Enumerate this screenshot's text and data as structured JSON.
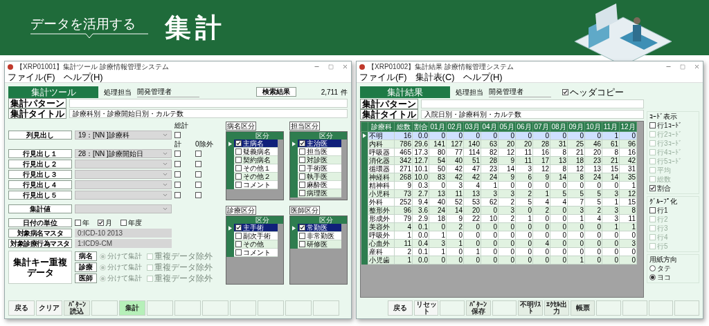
{
  "header": {
    "subtitle": "データを活用する",
    "title": "集計"
  },
  "tool_window": {
    "title": "【XRP01001】集計ツール 診療情報管理システム",
    "menu": [
      "ファイル(F)",
      "ヘルプ(H)"
    ],
    "heading": "集計ツール",
    "operator_label": "処理担当",
    "operator": "開発管理者",
    "search_button": "検索結果",
    "count": "2,711",
    "count_unit": "件",
    "pattern": {
      "label": "集計パターン"
    },
    "title_field": {
      "label": "集計タイトル",
      "value": "診療科別・診療開始日別・カルテ数"
    },
    "total_label": "総計",
    "sum_label": "計",
    "exclude_label": "0除外",
    "column_heading": {
      "label": "列見出し",
      "value": "19：[NN ]診療科",
      "total_checked": false
    },
    "row_headings": [
      {
        "label": "行見出し１",
        "value": "28：[NN ]診療開始日",
        "sum_checked": false,
        "exclude_checked": false
      },
      {
        "label": "行見出し２",
        "sum_checked": false,
        "exclude_checked": false
      },
      {
        "label": "行見出し３",
        "sum_checked": false,
        "exclude_checked": false
      },
      {
        "label": "行見出し４",
        "sum_checked": false,
        "exclude_checked": false
      },
      {
        "label": "行見出し５",
        "sum_checked": false,
        "exclude_checked": false
      }
    ],
    "value_field": {
      "label": "集計値"
    },
    "date_unit": {
      "label": "日付の単位",
      "options": [
        {
          "label": "年",
          "checked": false
        },
        {
          "label": "月",
          "checked": true
        },
        {
          "label": "年度",
          "checked": false
        }
      ]
    },
    "disease_master": {
      "label": "対象病名マスタ",
      "value": "0:ICD-10 2013"
    },
    "procedure_master": {
      "label": "対象診療行為マスタ",
      "value": "1:ICD9-CM"
    },
    "duplicate_key": {
      "label": "集計キー重複データ",
      "rows": [
        {
          "button": "病名",
          "radio": "分けて集計",
          "selected": true,
          "checkbox": "重複データ除外",
          "checked": false
        },
        {
          "button": "診療",
          "radio": "分けて集計",
          "selected": true,
          "checkbox": "重複データ除外",
          "checked": false
        },
        {
          "button": "医師",
          "radio": "分けて集計",
          "selected": true,
          "checkbox": "重複データ除外",
          "checked": false
        }
      ]
    },
    "grids": [
      {
        "title": "病名区分",
        "header": "区分",
        "rows": [
          {
            "label": "主病名",
            "checked": true,
            "selected": true
          },
          {
            "label": "疑義病名",
            "checked": false,
            "selected": false
          },
          {
            "label": "契約病名",
            "checked": false,
            "selected": false
          },
          {
            "label": "その他１",
            "checked": false,
            "selected": false
          },
          {
            "label": "その他２",
            "checked": false,
            "selected": false
          },
          {
            "label": "コメント",
            "checked": false,
            "selected": false
          }
        ]
      },
      {
        "title": "担当区分",
        "header": "区分",
        "rows": [
          {
            "label": "主治医",
            "checked": true,
            "selected": true
          },
          {
            "label": "担当医",
            "checked": false,
            "selected": false
          },
          {
            "label": "対診医",
            "checked": false,
            "selected": false
          },
          {
            "label": "手術医",
            "checked": false,
            "selected": false
          },
          {
            "label": "執手医",
            "checked": false,
            "selected": false
          },
          {
            "label": "麻酔医",
            "checked": false,
            "selected": false
          },
          {
            "label": "病理医",
            "checked": false,
            "selected": false
          }
        ]
      },
      {
        "title": "診療区分",
        "header": "区分",
        "rows": [
          {
            "label": "主手術",
            "checked": true,
            "selected": true
          },
          {
            "label": "副次手術",
            "checked": false,
            "selected": false
          },
          {
            "label": "その他",
            "checked": false,
            "selected": false
          },
          {
            "label": "コメント",
            "checked": false,
            "selected": false
          }
        ]
      },
      {
        "title": "医師区分",
        "header": "区分",
        "rows": [
          {
            "label": "常勤医",
            "checked": true,
            "selected": true
          },
          {
            "label": "非常勤医",
            "checked": false,
            "selected": false
          },
          {
            "label": "研修医",
            "checked": false,
            "selected": false
          }
        ]
      }
    ],
    "buttons": [
      {
        "kind": "normal",
        "label": "戻る"
      },
      {
        "kind": "normal",
        "label": "クリア"
      },
      {
        "kind": "muted",
        "label": "ﾊﾟﾀｰﾝ読込"
      },
      {
        "kind": "blank"
      },
      {
        "kind": "active",
        "label": "集計"
      },
      {
        "kind": "blank"
      },
      {
        "kind": "blank"
      },
      {
        "kind": "blank"
      },
      {
        "kind": "blank"
      },
      {
        "kind": "blank"
      },
      {
        "kind": "blank"
      },
      {
        "kind": "blank"
      }
    ]
  },
  "result_window": {
    "title": "【XRP01002】集計結果 診療情報管理システム",
    "menu": [
      "ファイル(F)",
      "集計表(C)",
      "ヘルプ(H)"
    ],
    "heading": "集計結果",
    "operator_label": "処理担当",
    "operator": "開発管理者",
    "header_copy": {
      "label": "ヘッダコピー",
      "checked": true
    },
    "pattern": {
      "label": "集計パターン"
    },
    "title_field": {
      "label": "集計タイトル",
      "value": "入院日別・診療科別・カルテ数"
    },
    "table": {
      "columns": [
        "診療科",
        "総数",
        "割合",
        "01月",
        "02月",
        "03月",
        "04月",
        "05月",
        "06月",
        "07月",
        "08月",
        "09月",
        "10月",
        "11月",
        "12月"
      ],
      "rows": [
        {
          "selected": true,
          "cells": [
            "不明",
            "16",
            "0.0",
            "0",
            "0",
            "0",
            "0",
            "0",
            "0",
            "0",
            "0",
            "0",
            "0",
            "1",
            "0"
          ]
        },
        {
          "selected": false,
          "cells": [
            "内科",
            "786",
            "29.6",
            "141",
            "127",
            "140",
            "63",
            "20",
            "20",
            "28",
            "31",
            "25",
            "46",
            "61",
            "96"
          ]
        },
        {
          "selected": false,
          "cells": [
            "呼吸器",
            "465",
            "17.3",
            "80",
            "77",
            "114",
            "82",
            "12",
            "11",
            "16",
            "8",
            "21",
            "20",
            "8",
            "16"
          ]
        },
        {
          "selected": false,
          "cells": [
            "消化器",
            "342",
            "12.7",
            "54",
            "40",
            "51",
            "28",
            "9",
            "11",
            "17",
            "13",
            "18",
            "23",
            "21",
            "42"
          ]
        },
        {
          "selected": false,
          "cells": [
            "循環器",
            "271",
            "10.1",
            "50",
            "42",
            "47",
            "23",
            "14",
            "3",
            "12",
            "8",
            "12",
            "13",
            "15",
            "31"
          ]
        },
        {
          "selected": false,
          "cells": [
            "神経科",
            "268",
            "10.0",
            "83",
            "42",
            "42",
            "24",
            "9",
            "6",
            "9",
            "14",
            "8",
            "24",
            "14",
            "35"
          ]
        },
        {
          "selected": false,
          "cells": [
            "精神科",
            "9",
            "0.3",
            "0",
            "3",
            "4",
            "1",
            "0",
            "0",
            "0",
            "0",
            "0",
            "0",
            "0",
            "1"
          ]
        },
        {
          "selected": false,
          "cells": [
            "小児科",
            "73",
            "2.7",
            "13",
            "11",
            "13",
            "3",
            "3",
            "2",
            "1",
            "5",
            "5",
            "5",
            "3",
            "12"
          ]
        },
        {
          "selected": false,
          "cells": [
            "外科",
            "252",
            "9.4",
            "40",
            "52",
            "53",
            "62",
            "2",
            "5",
            "4",
            "4",
            "7",
            "5",
            "1",
            "15"
          ]
        },
        {
          "selected": false,
          "cells": [
            "整形外",
            "96",
            "3.6",
            "24",
            "14",
            "20",
            "0",
            "3",
            "0",
            "2",
            "0",
            "3",
            "2",
            "3",
            "8"
          ]
        },
        {
          "selected": false,
          "cells": [
            "形成外",
            "79",
            "2.9",
            "18",
            "9",
            "22",
            "10",
            "2",
            "1",
            "0",
            "0",
            "1",
            "4",
            "3",
            "11"
          ]
        },
        {
          "selected": false,
          "cells": [
            "美容外",
            "4",
            "0.1",
            "0",
            "2",
            "0",
            "0",
            "0",
            "0",
            "0",
            "0",
            "0",
            "0",
            "1",
            "1"
          ]
        },
        {
          "selected": false,
          "cells": [
            "呼吸外",
            "1",
            "0.0",
            "1",
            "0",
            "0",
            "0",
            "0",
            "0",
            "0",
            "0",
            "0",
            "0",
            "0",
            "0"
          ]
        },
        {
          "selected": false,
          "cells": [
            "心血外",
            "11",
            "0.4",
            "3",
            "1",
            "0",
            "0",
            "0",
            "0",
            "4",
            "0",
            "0",
            "0",
            "0",
            "3"
          ]
        },
        {
          "selected": false,
          "cells": [
            "産科",
            "2",
            "0.1",
            "1",
            "0",
            "1",
            "0",
            "0",
            "0",
            "0",
            "0",
            "0",
            "0",
            "0",
            "0"
          ]
        },
        {
          "selected": false,
          "cells": [
            "小児歯",
            "1",
            "0.0",
            "0",
            "0",
            "0",
            "0",
            "0",
            "0",
            "0",
            "0",
            "1",
            "0",
            "0",
            "0"
          ]
        }
      ]
    },
    "code_display": {
      "title": "ｺｰﾄﾞ表示",
      "options": [
        {
          "label": "行1ｺｰﾄﾞ",
          "checked": false,
          "disabled": false
        },
        {
          "label": "行2ｺｰﾄﾞ",
          "checked": false,
          "disabled": true
        },
        {
          "label": "行3ｺｰﾄﾞ",
          "checked": false,
          "disabled": true
        },
        {
          "label": "行4ｺｰﾄﾞ",
          "checked": false,
          "disabled": true
        },
        {
          "label": "行5ｺｰﾄﾞ",
          "checked": false,
          "disabled": true
        },
        {
          "label": "平均",
          "checked": false,
          "disabled": true
        },
        {
          "label": "総数",
          "checked": false,
          "disabled": true
        },
        {
          "label": "割合",
          "checked": true,
          "disabled": false
        }
      ]
    },
    "grouping": {
      "title": "ｸﾞﾙｰﾌﾟ化",
      "options": [
        {
          "label": "行1",
          "checked": false,
          "disabled": false
        },
        {
          "label": "行2",
          "checked": false,
          "disabled": true
        },
        {
          "label": "行3",
          "checked": false,
          "disabled": true
        },
        {
          "label": "行4",
          "checked": false,
          "disabled": true
        },
        {
          "label": "行5",
          "checked": false,
          "disabled": true
        }
      ]
    },
    "orientation": {
      "title": "用紙方向",
      "options": [
        {
          "label": "タテ",
          "selected": false
        },
        {
          "label": "ヨコ",
          "selected": true
        }
      ]
    },
    "buttons": [
      {
        "kind": "normal",
        "label": "戻る"
      },
      {
        "kind": "normal",
        "label": "リセット"
      },
      {
        "kind": "blank"
      },
      {
        "kind": "muted",
        "label": "ﾊﾟﾀｰﾝ保存"
      },
      {
        "kind": "blank"
      },
      {
        "kind": "muted",
        "label": "不明ﾘｽﾄ"
      },
      {
        "kind": "muted",
        "label": "ｴｸｾﾙ出力"
      },
      {
        "kind": "muted",
        "label": "帳票"
      },
      {
        "kind": "blank"
      },
      {
        "kind": "blank"
      },
      {
        "kind": "blank"
      },
      {
        "kind": "blank"
      }
    ]
  }
}
